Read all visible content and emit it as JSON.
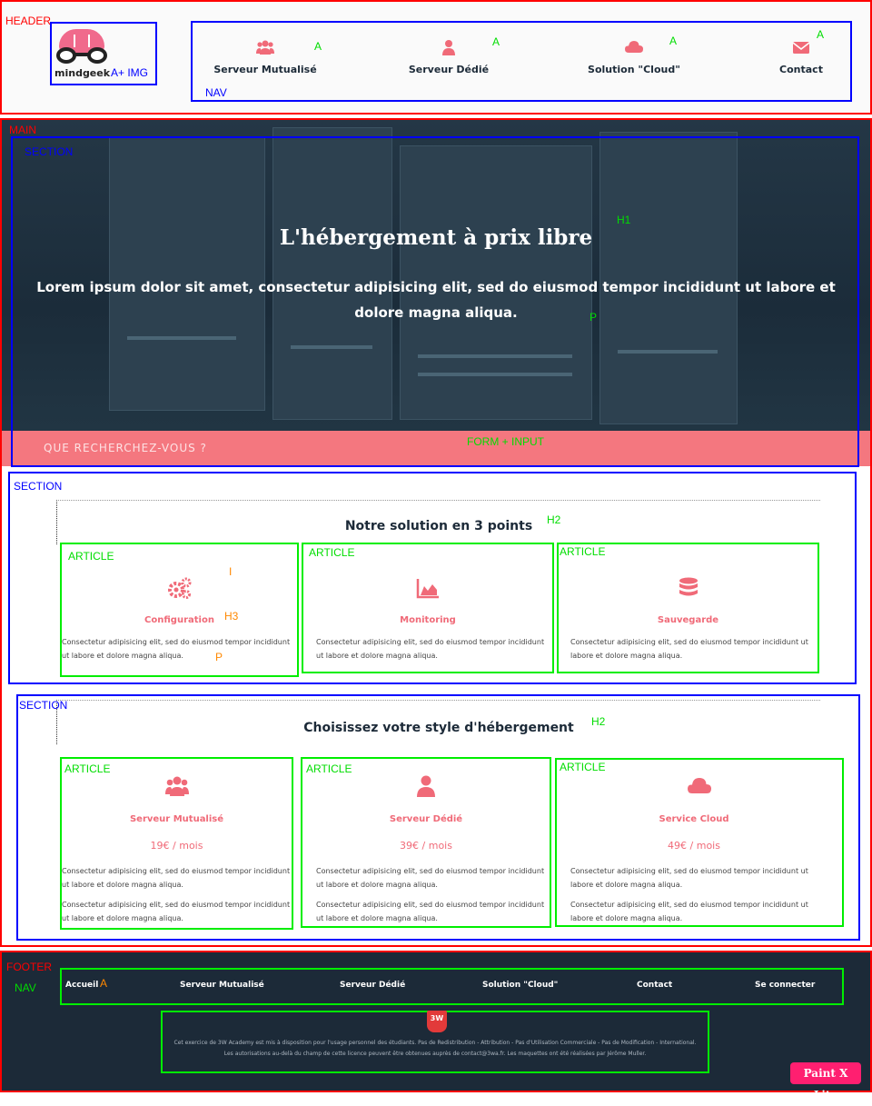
{
  "annotations": {
    "header": "HEADER",
    "a_img": "A+ IMG",
    "nav": "NAV",
    "a": "A",
    "main": "MAIN",
    "section": "SECTION",
    "h1": "H1",
    "p": "P",
    "form_input": "FORM + INPUT",
    "h2": "H2",
    "article": "ARTICLE",
    "i": "I",
    "h3": "H3",
    "footer": "FOOTER"
  },
  "header": {
    "logo_text": "mindgeek",
    "nav": [
      {
        "label": "Serveur Mutualisé",
        "icon": "users-icon"
      },
      {
        "label": "Serveur Dédié",
        "icon": "user-icon"
      },
      {
        "label": "Solution \"Cloud\"",
        "icon": "cloud-icon"
      },
      {
        "label": "Contact",
        "icon": "envelope-icon"
      }
    ]
  },
  "hero": {
    "title": "L'hébergement à prix libre",
    "text": "Lorem ipsum dolor sit amet, consectetur adipisicing elit, sed do eiusmod tempor incididunt ut labore et dolore magna aliqua.",
    "search_placeholder": "QUE RECHERCHEZ-VOUS ?"
  },
  "points": {
    "title": "Notre solution en 3 points",
    "cards": [
      {
        "title": "Configuration",
        "icon": "gears-icon",
        "text": "Consectetur adipisicing elit, sed do eiusmod tempor incididunt ut labore et dolore magna aliqua."
      },
      {
        "title": "Monitoring",
        "icon": "area-chart-icon",
        "text": "Consectetur adipisicing elit, sed do eiusmod tempor incididunt ut labore et dolore magna aliqua."
      },
      {
        "title": "Sauvegarde",
        "icon": "database-icon",
        "text": "Consectetur adipisicing elit, sed do eiusmod tempor incididunt ut labore et dolore magna aliqua."
      }
    ]
  },
  "hosting": {
    "title": "Choisissez votre style d'hébergement",
    "cards": [
      {
        "title": "Serveur Mutualisé",
        "icon": "users-icon",
        "price": "19€ / mois",
        "text1": "Consectetur adipisicing elit, sed do eiusmod tempor incididunt ut labore et dolore magna aliqua.",
        "text2": "Consectetur adipisicing elit, sed do eiusmod tempor incididunt ut labore et dolore magna aliqua."
      },
      {
        "title": "Serveur Dédié",
        "icon": "user-icon",
        "price": "39€ / mois",
        "text1": "Consectetur adipisicing elit, sed do eiusmod tempor incididunt ut labore et dolore magna aliqua.",
        "text2": "Consectetur adipisicing elit, sed do eiusmod tempor incididunt ut labore et dolore magna aliqua."
      },
      {
        "title": "Service Cloud",
        "icon": "cloud-icon",
        "price": "49€ / mois",
        "text1": "Consectetur adipisicing elit, sed do eiusmod tempor incididunt ut labore et dolore magna aliqua.",
        "text2": "Consectetur adipisicing elit, sed do eiusmod tempor incididunt ut labore et dolore magna aliqua."
      }
    ]
  },
  "footer": {
    "nav": [
      "Accueil",
      "Serveur Mutualisé",
      "Serveur Dédié",
      "Solution \"Cloud\"",
      "Contact",
      "Se connecter"
    ],
    "badge": "3W",
    "credit_1": "Cet exercice de 3W Academy est mis à disposition pour l'usage personnel des étudiants. Pas de Redistribution - Attribution - Pas d'Utilisation Commerciale - Pas de Modification - International.",
    "credit_2": "Les autorisations au-delà du champ de cette licence peuvent être obtenues auprès de contact@3wa.fr. Les maquettes ont été réalisées par Jérôme Muller.",
    "paint": "Paint X Lite"
  },
  "colors": {
    "accent": "#f06a78",
    "dark": "#1c2a38",
    "search_bar": "#f4777f"
  }
}
